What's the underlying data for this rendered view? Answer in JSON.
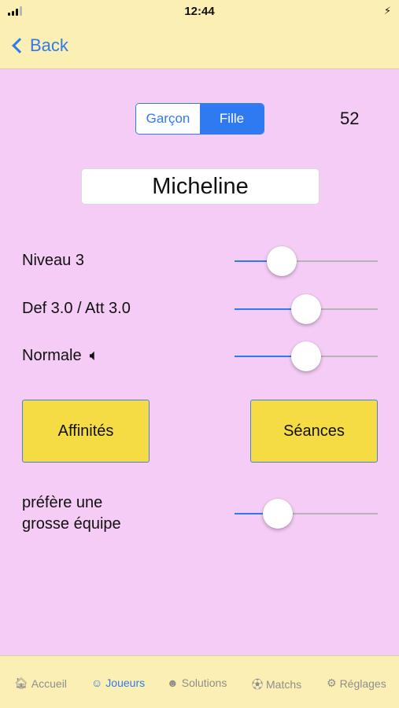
{
  "status_bar": {
    "time": "12:44"
  },
  "nav": {
    "back_label": "Back"
  },
  "gender": {
    "options": [
      "Garçon",
      "Fille"
    ],
    "selected": "Fille"
  },
  "player_count": "52",
  "player_name": "Micheline",
  "settings": [
    {
      "label": "Niveau 3",
      "slider_fraction": 0.33
    },
    {
      "label": "Def 3.0 / Att 3.0",
      "slider_fraction": 0.5
    },
    {
      "label": "Normale",
      "icon": "speaker-icon",
      "slider_fraction": 0.5
    }
  ],
  "buttons": {
    "affinites": "Affinités",
    "seances": "Séances"
  },
  "preference": {
    "line1": "préfère une",
    "line2": "grosse équipe",
    "slider_fraction": 0.3
  },
  "tabs": [
    {
      "label": "Accueil",
      "icon": "house-icon",
      "active": false
    },
    {
      "label": "Joueurs",
      "icon": "smiley-icon",
      "active": true
    },
    {
      "label": "Solutions",
      "icon": "people-icon",
      "active": false
    },
    {
      "label": "Matchs",
      "icon": "ball-icon",
      "active": false
    },
    {
      "label": "Réglages",
      "icon": "gear-icon",
      "active": false
    }
  ],
  "colors": {
    "background": "#f5ccf5",
    "bars": "#fbefb4",
    "accent": "#2f7af0",
    "button": "#f5dc45"
  }
}
